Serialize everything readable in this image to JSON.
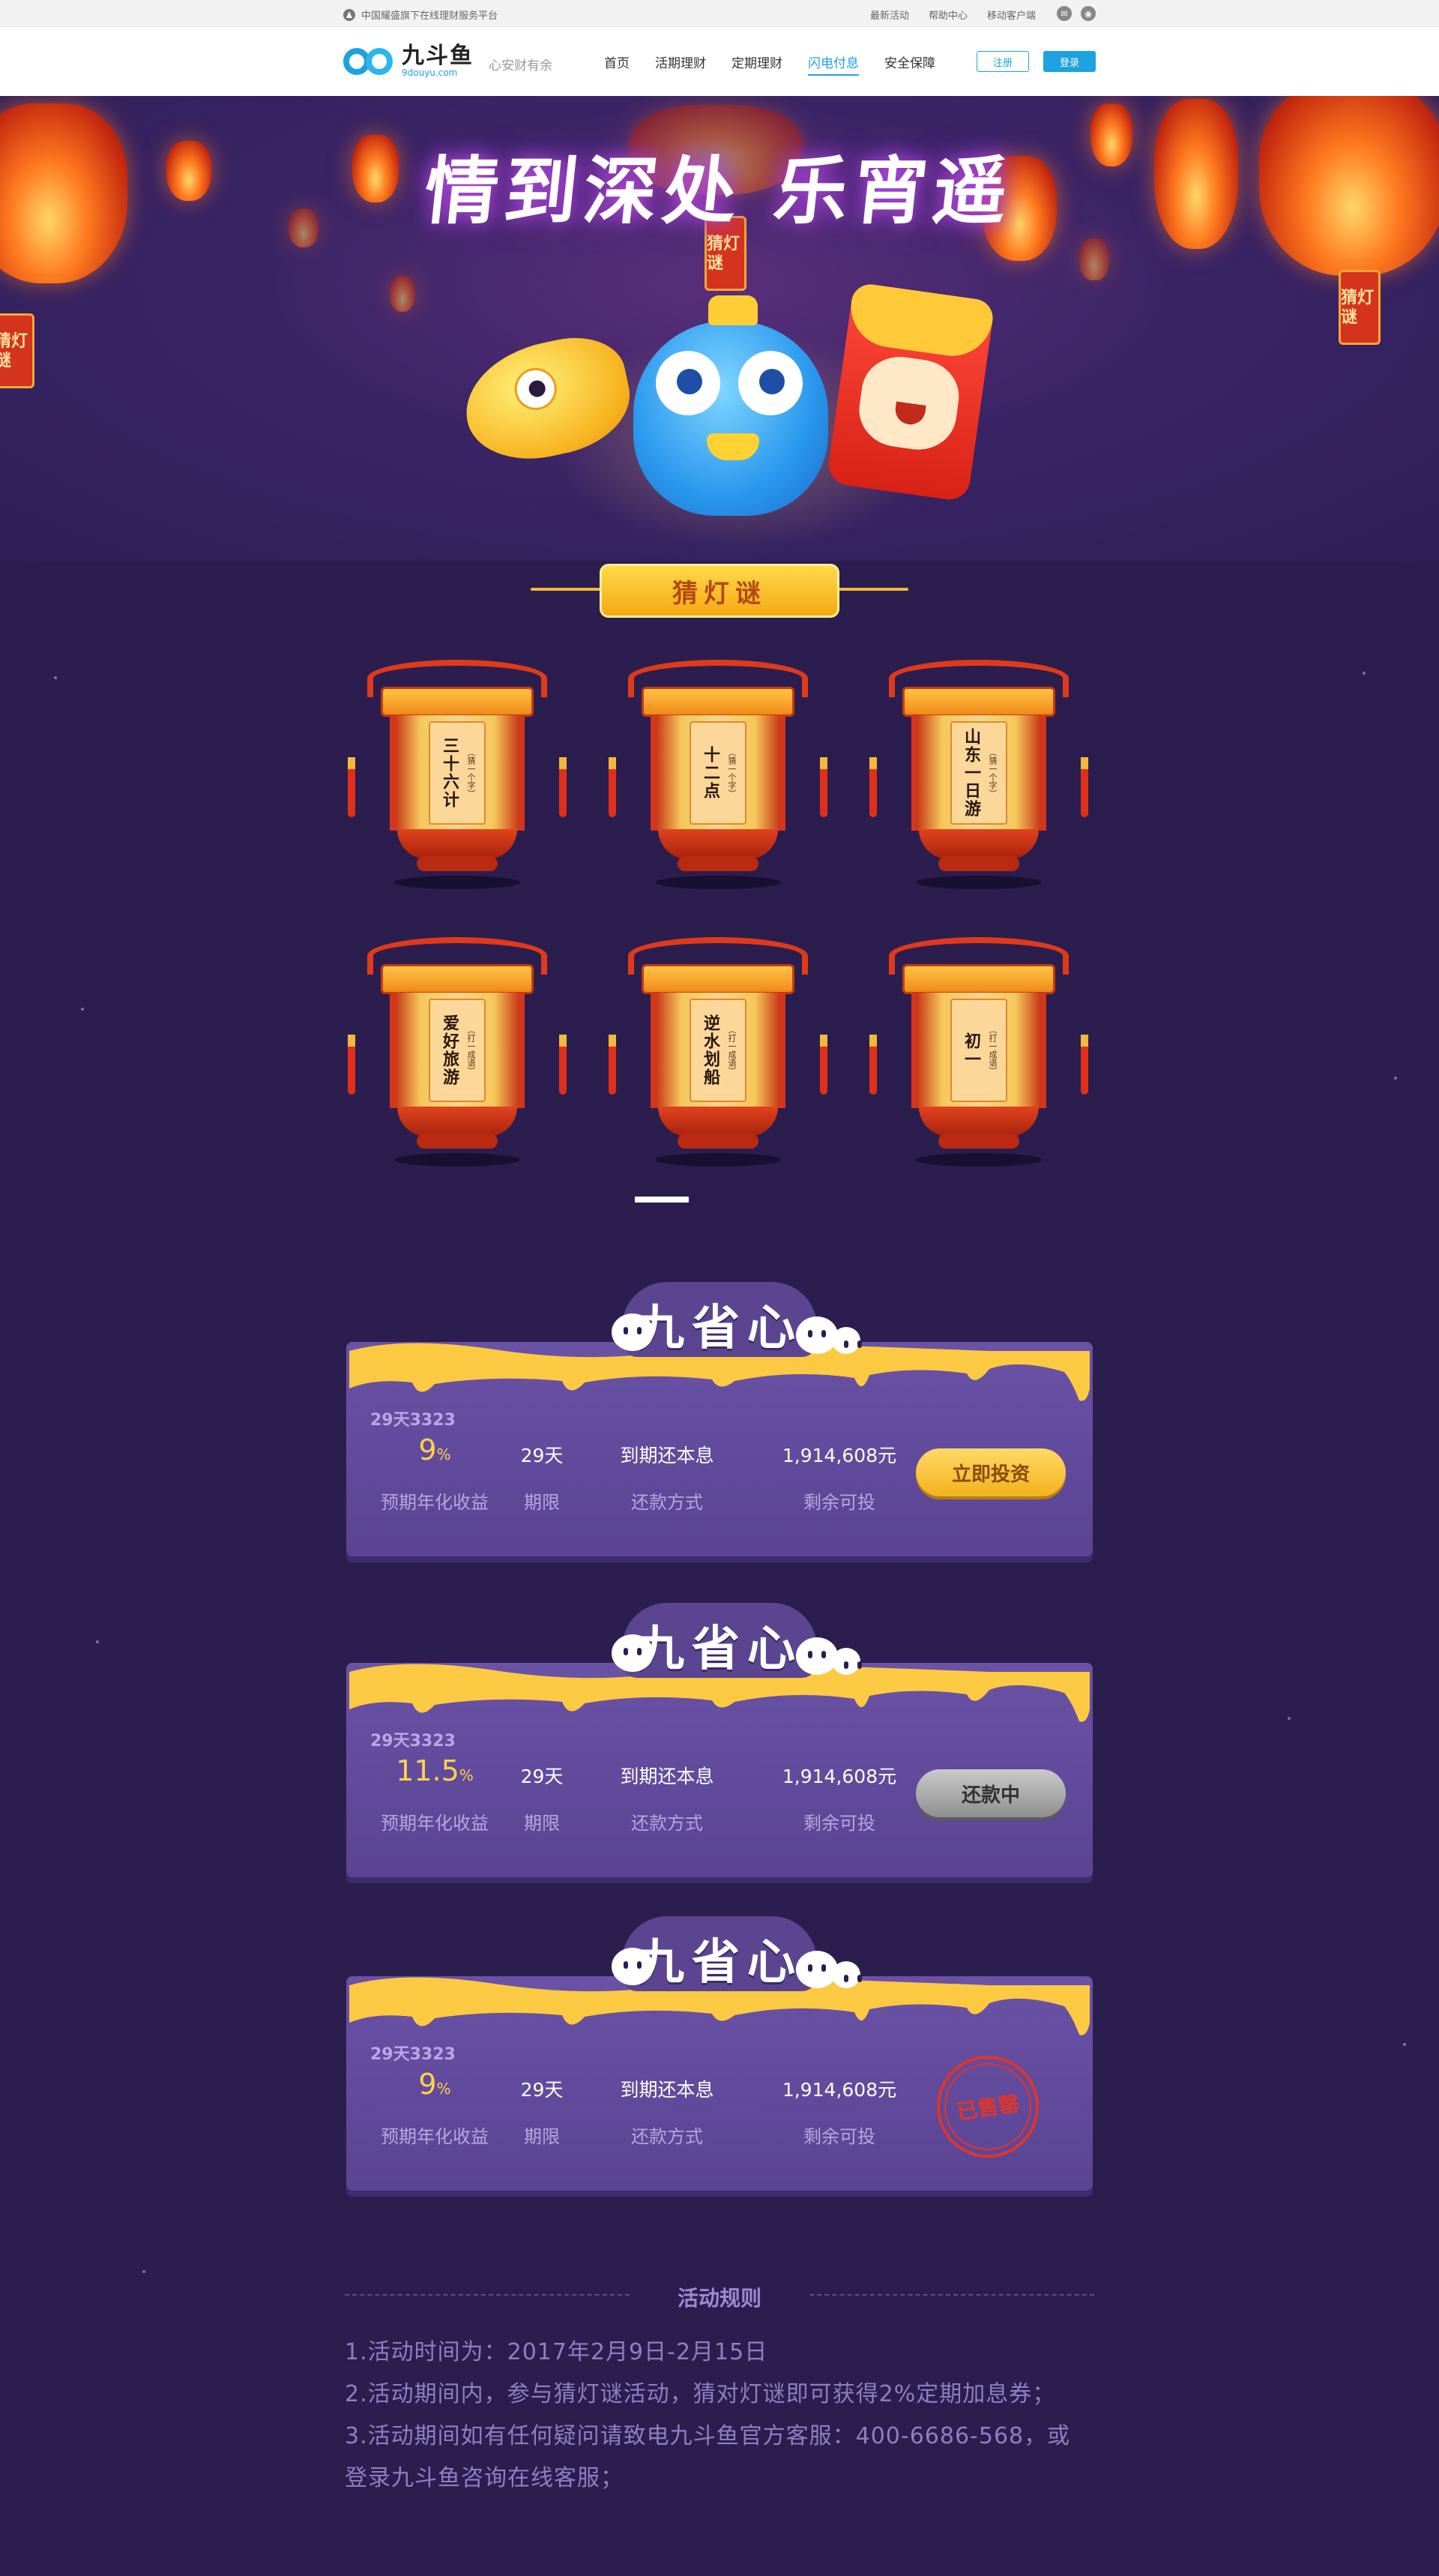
{
  "topbar": {
    "tagline": "中国耀盛旗下在线理财服务平台",
    "links": [
      "最新活动",
      "帮助中心",
      "移动客户端"
    ],
    "social_icons": [
      "wechat-icon",
      "weibo-icon"
    ]
  },
  "header": {
    "logo_cn": "九斗鱼",
    "logo_en": "9douyu.com",
    "slogan": "心安财有余",
    "nav": [
      "首页",
      "活期理财",
      "定期理财",
      "闪电付息",
      "安全保障"
    ],
    "active_nav": "闪电付息",
    "register_label": "注册",
    "login_label": "登录",
    "brand_color": "#1ea1e0"
  },
  "hero": {
    "title": "情到深处 乐宵遥",
    "tag_text": "猜灯谜"
  },
  "riddles": {
    "banner": "猜灯谜",
    "items": [
      {
        "text": "三十六计",
        "hint": "（猜一个字）"
      },
      {
        "text": "十二点",
        "hint": "（猜一个字）"
      },
      {
        "text": "山东一日游",
        "hint": "（猜一个字）"
      },
      {
        "text": "爱好旅游",
        "hint": "（打一成语）"
      },
      {
        "text": "逆水划船",
        "hint": "（打一成语）"
      },
      {
        "text": "初一",
        "hint": "（打一成语）"
      }
    ]
  },
  "products": [
    {
      "title": "九省心",
      "id": "29天3323",
      "rate": "9",
      "rate_unit": "%",
      "term": "29天",
      "repay_method": "到期还本息",
      "remaining": "1,914,608元",
      "labels": [
        "预期年化收益",
        "期限",
        "还款方式",
        "剩余可投"
      ],
      "status": "invest",
      "action_label": "立即投资"
    },
    {
      "title": "九省心",
      "id": "29天3323",
      "rate": "11.5",
      "rate_unit": "%",
      "term": "29天",
      "repay_method": "到期还本息",
      "remaining": "1,914,608元",
      "labels": [
        "预期年化收益",
        "期限",
        "还款方式",
        "剩余可投"
      ],
      "status": "repaying",
      "action_label": "还款中"
    },
    {
      "title": "九省心",
      "id": "29天3323",
      "rate": "9",
      "rate_unit": "%",
      "term": "29天",
      "repay_method": "到期还本息",
      "remaining": "1,914,608元",
      "labels": [
        "预期年化收益",
        "期限",
        "还款方式",
        "剩余可投"
      ],
      "status": "soldout",
      "action_label": "已售罄"
    }
  ],
  "rules": {
    "title": "活动规则",
    "items": [
      "1.活动时间为：2017年2月9日-2月15日",
      "2.活动期间内，参与猜灯谜活动，猜对灯谜即可获得2%定期加息券；",
      "3.活动期间如有任何疑问请致电九斗鱼官方客服：400-6686-568，或",
      "登录九斗鱼咨询在线客服；"
    ]
  },
  "colors": {
    "page_bg": "#2b1e4f",
    "card_bg": "#6a52a6",
    "rate_color": "#ffd24a",
    "stamp_red": "#e0352b"
  }
}
